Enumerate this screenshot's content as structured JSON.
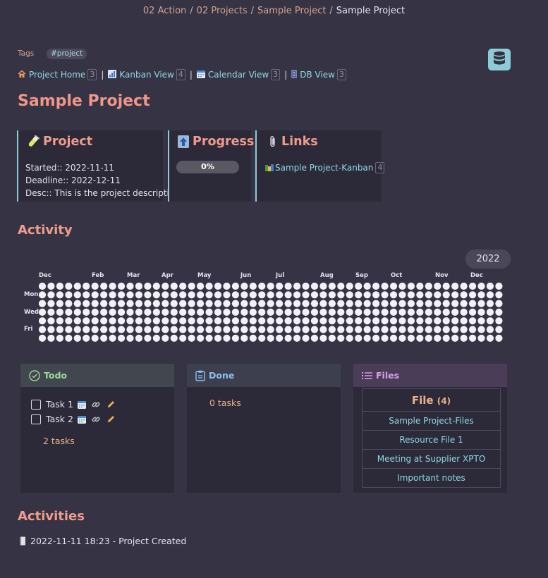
{
  "breadcrumb": {
    "items": [
      "02 Action",
      "02 Projects",
      "Sample Project"
    ],
    "current": "Sample Project",
    "separator": "/"
  },
  "tags": {
    "label": "Tags",
    "value": "#project"
  },
  "db_button": {
    "icon": "database-icon"
  },
  "views": [
    {
      "icon": "house-icon",
      "label": "Project Home",
      "count": "3"
    },
    {
      "icon": "bar-chart-icon",
      "label": "Kanban View",
      "count": "4"
    },
    {
      "icon": "calendar-icon",
      "label": "Calendar View",
      "count": "3"
    },
    {
      "icon": "filing-cabinet-icon",
      "label": "DB View",
      "count": "3"
    }
  ],
  "view_separator": "|",
  "title": "Sample Project",
  "project_card": {
    "heading": "Project",
    "icon": "test-tube-icon",
    "started": "Started:: 2022-11-11",
    "deadline": "Deadline:: 2022-12-11",
    "desc": "Desc:: This is the project description"
  },
  "progress_card": {
    "heading": "Progress",
    "icon": "up-arrow-icon",
    "value": 0,
    "label": "0%"
  },
  "links_card": {
    "heading": "Links",
    "icon": "paperclip-icon",
    "items": [
      {
        "icon": "books-icon",
        "label": "Sample Project-Kanban",
        "count": "4"
      }
    ]
  },
  "activity": {
    "heading": "Activity",
    "year": "2022",
    "months": [
      "Dec",
      "Feb",
      "Mar",
      "Apr",
      "May",
      "Jun",
      "Jul",
      "Aug",
      "Sep",
      "Oct",
      "Nov",
      "Dec"
    ],
    "days": [
      "Mon",
      "Wed",
      "Fri"
    ],
    "weeks": 53,
    "rows": 7
  },
  "todo": {
    "heading": "Todo",
    "icon": "check-circle-icon",
    "tasks": [
      {
        "label": "Task 1",
        "done": false
      },
      {
        "label": "Task 2",
        "done": false
      }
    ],
    "count": "2 tasks"
  },
  "done": {
    "heading": "Done",
    "icon": "clipboard-icon",
    "count": "0 tasks"
  },
  "files": {
    "heading": "Files",
    "icon": "list-icon",
    "table_header": "File",
    "table_count": "(4)",
    "items": [
      "Sample Project-Files",
      "Resource File 1",
      "Meeting at Supplier XPTO",
      "Important notes"
    ]
  },
  "activities": {
    "heading": "Activities",
    "items": [
      {
        "icon": "book-icon",
        "text": "2022-11-11 18:23 - Project Created"
      }
    ]
  },
  "colors": {
    "background": "#363444",
    "accent_salmon": "#f09c8c",
    "link_cyan": "#8ed8e8",
    "card_border": "#8ecbd8",
    "todo_header": "#41464f",
    "done_header": "#3d3f4f",
    "files_header": "#4a3d58"
  }
}
